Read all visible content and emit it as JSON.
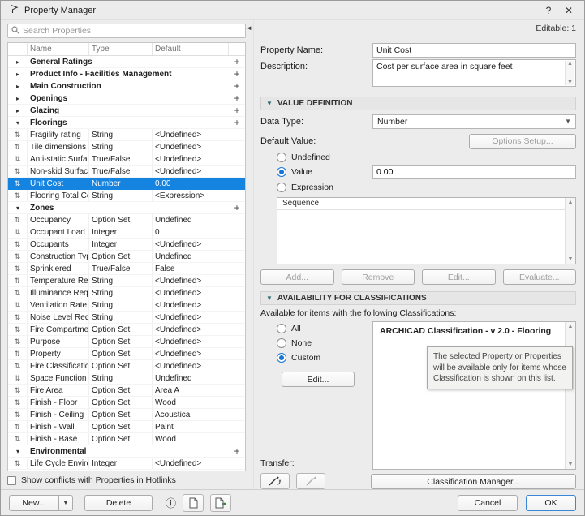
{
  "colors": {
    "selection": "#1583e0",
    "accent": "#1576d6"
  },
  "window": {
    "title": "Property Manager",
    "help": "?",
    "close": "✕"
  },
  "left": {
    "search_placeholder": "Search Properties",
    "columns": [
      "Name",
      "Type",
      "Default"
    ],
    "rows": [
      {
        "kind": "group",
        "name": "General Ratings",
        "expanded": false
      },
      {
        "kind": "group",
        "name": "Product Info - Facilities Management",
        "expanded": false
      },
      {
        "kind": "group",
        "name": "Main Construction",
        "expanded": false
      },
      {
        "kind": "group",
        "name": "Openings",
        "expanded": false
      },
      {
        "kind": "group",
        "name": "Glazing",
        "expanded": false
      },
      {
        "kind": "group",
        "name": "Floorings",
        "expanded": true
      },
      {
        "kind": "prop",
        "name": "Fragility rating",
        "type": "String",
        "default": "<Undefined>"
      },
      {
        "kind": "prop",
        "name": "Tile dimensions",
        "type": "String",
        "default": "<Undefined>"
      },
      {
        "kind": "prop",
        "name": "Anti-static Surface",
        "type": "True/False",
        "default": "<Undefined>"
      },
      {
        "kind": "prop",
        "name": "Non-skid Surface",
        "type": "True/False",
        "default": "<Undefined>"
      },
      {
        "kind": "prop",
        "name": "Unit Cost",
        "type": "Number",
        "default": "0.00",
        "selected": true
      },
      {
        "kind": "prop",
        "name": "Flooring Total Cost",
        "type": "String",
        "default": "<Expression>"
      },
      {
        "kind": "group",
        "name": "Zones",
        "expanded": true
      },
      {
        "kind": "prop",
        "name": "Occupancy",
        "type": "Option Set",
        "default": "Undefined"
      },
      {
        "kind": "prop",
        "name": "Occupant Load",
        "type": "Integer",
        "default": "0"
      },
      {
        "kind": "prop",
        "name": "Occupants",
        "type": "Integer",
        "default": "<Undefined>"
      },
      {
        "kind": "prop",
        "name": "Construction Types",
        "type": "Option Set",
        "default": "Undefined"
      },
      {
        "kind": "prop",
        "name": "Sprinklered",
        "type": "True/False",
        "default": "False"
      },
      {
        "kind": "prop",
        "name": "Temperature Requ..",
        "type": "String",
        "default": "<Undefined>"
      },
      {
        "kind": "prop",
        "name": "Illuminance Requ...",
        "type": "String",
        "default": "<Undefined>"
      },
      {
        "kind": "prop",
        "name": "Ventilation Rate ...",
        "type": "String",
        "default": "<Undefined>"
      },
      {
        "kind": "prop",
        "name": "Noise Level Requ...",
        "type": "String",
        "default": "<Undefined>"
      },
      {
        "kind": "prop",
        "name": "Fire Compartment",
        "type": "Option Set",
        "default": "<Undefined>"
      },
      {
        "kind": "prop",
        "name": "Purpose",
        "type": "Option Set",
        "default": "<Undefined>"
      },
      {
        "kind": "prop",
        "name": "Property",
        "type": "Option Set",
        "default": "<Undefined>"
      },
      {
        "kind": "prop",
        "name": "Fire Classification",
        "type": "Option Set",
        "default": "<Undefined>"
      },
      {
        "kind": "prop",
        "name": "Space Function",
        "type": "String",
        "default": "Undefined"
      },
      {
        "kind": "prop",
        "name": "Fire Area",
        "type": "Option Set",
        "default": "Area A"
      },
      {
        "kind": "prop",
        "name": "Finish - Floor",
        "type": "Option Set",
        "default": "Wood"
      },
      {
        "kind": "prop",
        "name": "Finish - Ceiling",
        "type": "Option Set",
        "default": "Acoustical"
      },
      {
        "kind": "prop",
        "name": "Finish - Wall",
        "type": "Option Set",
        "default": "Paint"
      },
      {
        "kind": "prop",
        "name": "Finish - Base",
        "type": "Option Set",
        "default": "Wood"
      },
      {
        "kind": "group",
        "name": "Environmental",
        "expanded": true
      },
      {
        "kind": "prop",
        "name": "Life Cycle Environ...",
        "type": "Integer",
        "default": "<Undefined>"
      }
    ],
    "conflicts_checkbox": "Show conflicts with Properties in Hotlinks",
    "conflicts_checked": false,
    "new_button": "New...",
    "delete_button": "Delete"
  },
  "right": {
    "editable": "Editable: 1",
    "property_name_label": "Property Name:",
    "property_name_value": "Unit Cost",
    "description_label": "Description:",
    "description_value": "Cost per surface area in square feet",
    "value_definition": {
      "header": "VALUE DEFINITION",
      "data_type_label": "Data Type:",
      "data_type_value": "Number",
      "default_value_label": "Default Value:",
      "options_setup": "Options Setup...",
      "radio_undefined": "Undefined",
      "radio_value": "Value",
      "value_field": "0.00",
      "radio_expression": "Expression",
      "radios_state": {
        "undefined": false,
        "value": true,
        "expression": false
      },
      "sequence_header": "Sequence",
      "add_button": "Add...",
      "remove_button": "Remove",
      "edit_button": "Edit...",
      "evaluate_button": "Evaluate..."
    },
    "availability": {
      "header": "AVAILABILITY FOR CLASSIFICATIONS",
      "subtitle": "Available for items with the following Classifications:",
      "radio_all": "All",
      "radio_none": "None",
      "radio_custom": "Custom",
      "radios_state": {
        "all": false,
        "none": false,
        "custom": true
      },
      "edit_button": "Edit...",
      "classification_item": "ARCHICAD Classification - v 2.0 - Flooring",
      "tooltip": "The selected Property or Properties will be available only for items whose Classification is shown on this list.",
      "transfer_label": "Transfer:",
      "classification_manager_button": "Classification Manager..."
    },
    "footer": {
      "cancel": "Cancel",
      "ok": "OK"
    }
  }
}
